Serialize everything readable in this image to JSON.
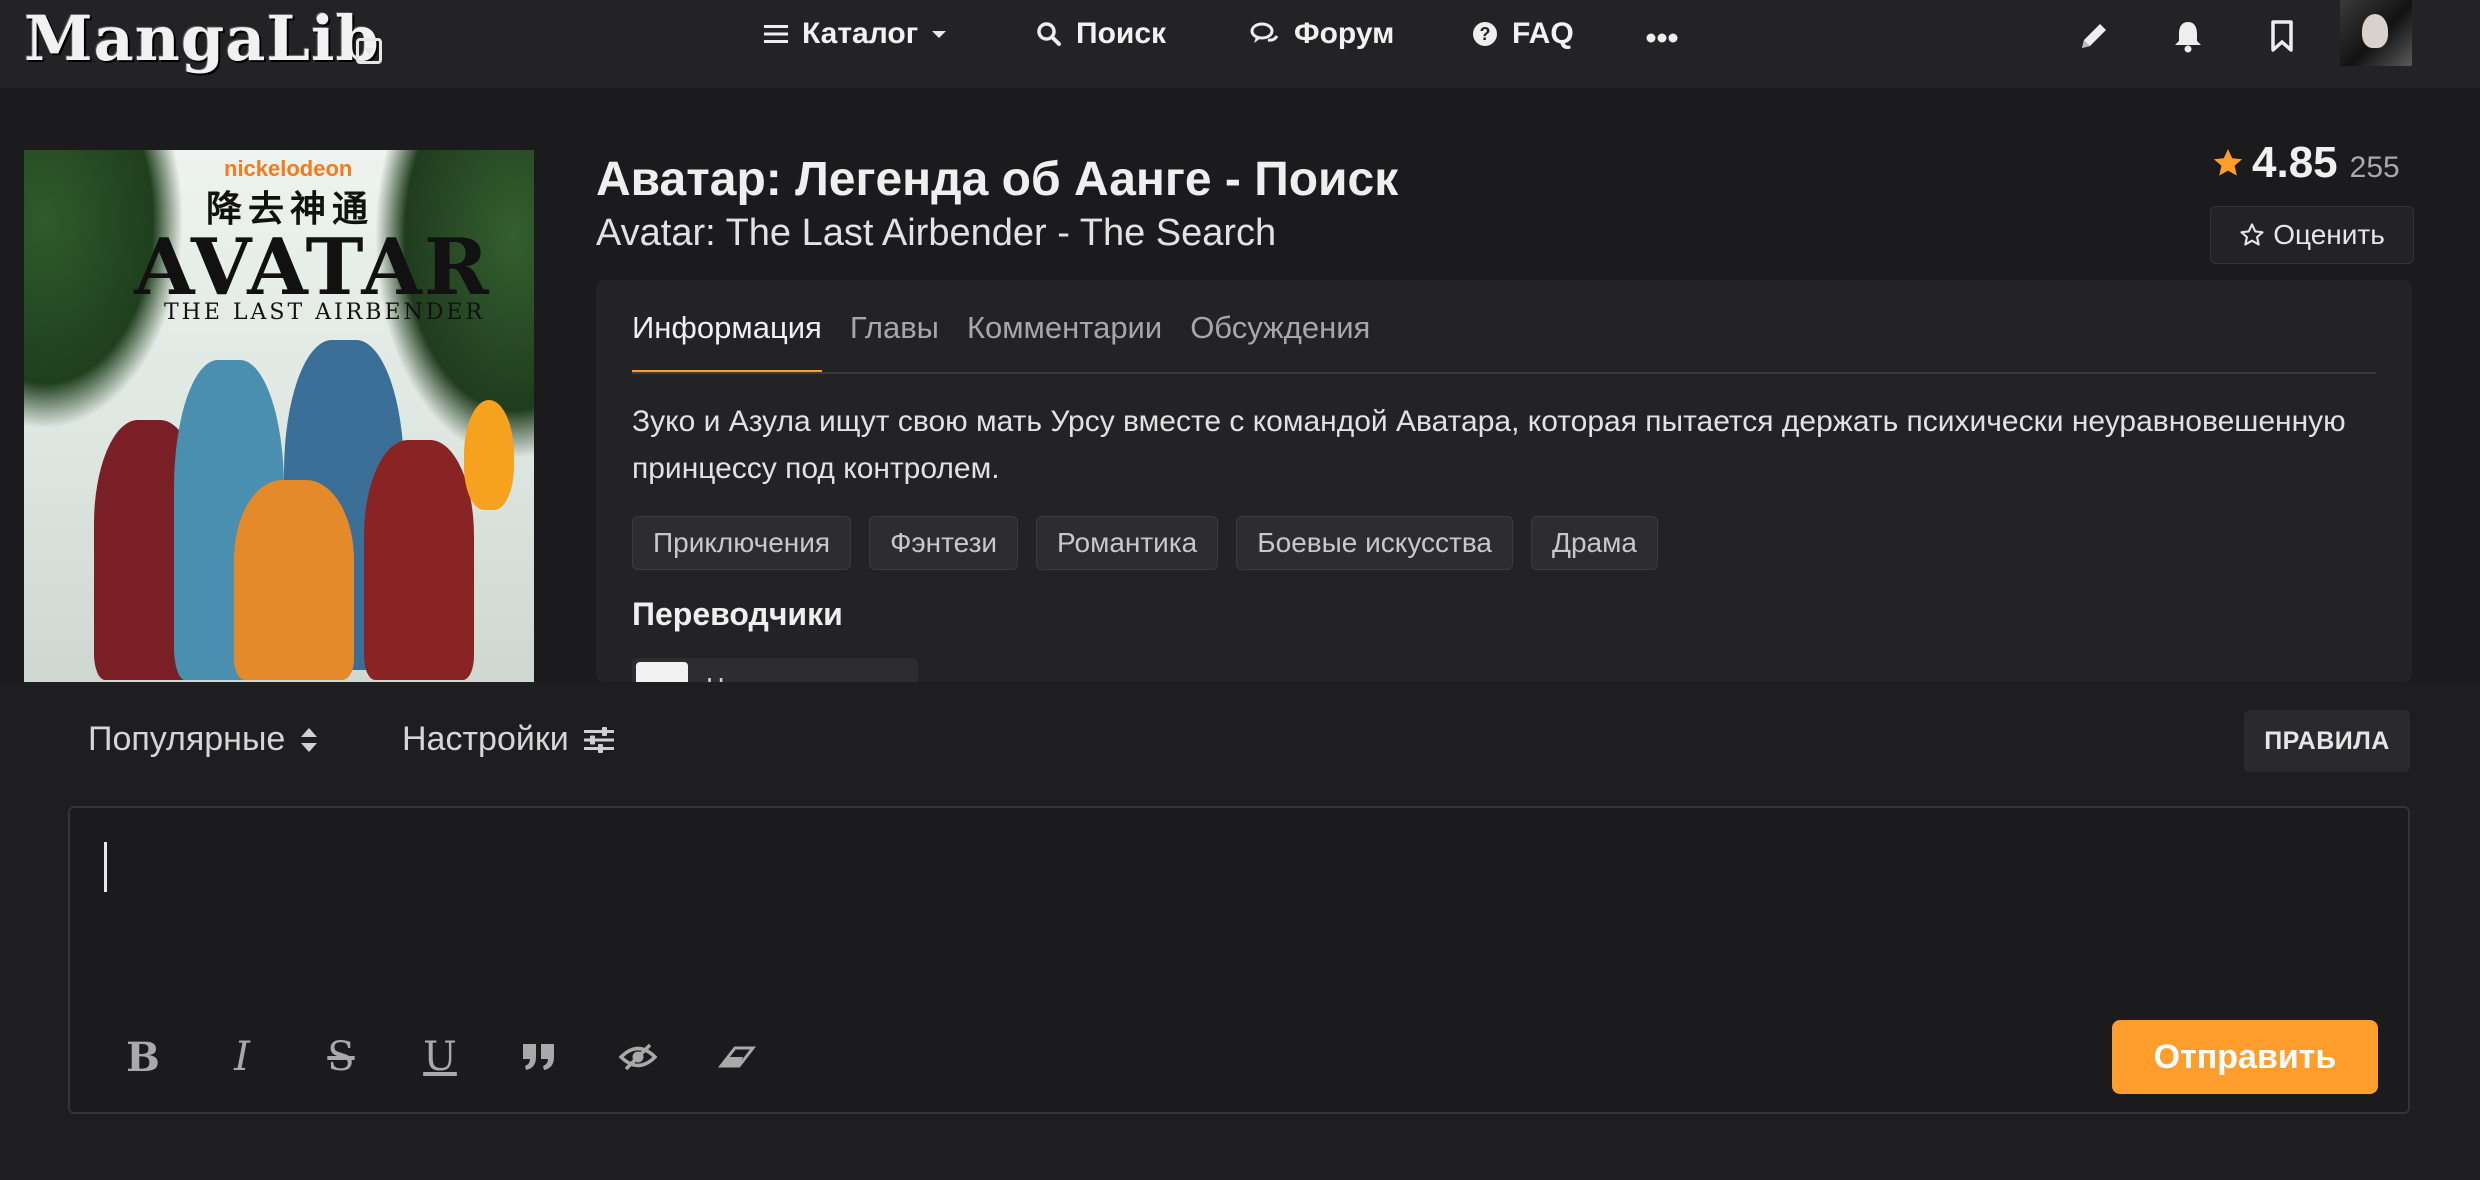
{
  "header": {
    "logo": "MangaLib",
    "nav": [
      {
        "label": "Каталог",
        "icon": "menu-icon"
      },
      {
        "label": "Поиск",
        "icon": "search-icon"
      },
      {
        "label": "Форум",
        "icon": "chat-icon"
      },
      {
        "label": "FAQ",
        "icon": "help-icon"
      }
    ],
    "more_icon": "ellipsis-icon",
    "actions": [
      "pencil-icon",
      "bell-icon",
      "bookmark-icon"
    ]
  },
  "manga": {
    "cover": {
      "brand": "nickelodeon",
      "cjk_title": "降去神通",
      "title": "AVATAR",
      "subtitle": "THE LAST AIRBENDER"
    },
    "title_ru": "Аватар: Легенда об Аанге - Поиск",
    "title_en": "Avatar: The Last Airbender - The Search",
    "rating": {
      "value": "4.85",
      "count": "255"
    },
    "rate_button": "Оценить",
    "tabs": [
      {
        "label": "Информация",
        "active": true
      },
      {
        "label": "Главы",
        "active": false
      },
      {
        "label": "Комментарии",
        "active": false
      },
      {
        "label": "Обсуждения",
        "active": false
      }
    ],
    "description": "Зуко и Азула ищут свою мать Урсу вместе с командой Аватара, которая пытается держать психически неуравновешенную принцессу под контролем.",
    "genres": [
      "Приключения",
      "Фэнтези",
      "Романтика",
      "Боевые искусства",
      "Драма"
    ],
    "translators_heading": "Переводчики",
    "translator_team": "Чудо-камикадзе"
  },
  "comments": {
    "sort_label": "Популярные",
    "settings_label": "Настройки",
    "rules_button": "ПРАВИЛА",
    "input_value": "",
    "toolbar": [
      "bold-icon",
      "italic-icon",
      "strikethrough-icon",
      "underline-icon",
      "quote-icon",
      "spoiler-icon",
      "eraser-icon"
    ],
    "submit_button": "Отправить"
  },
  "colors": {
    "accent": "#ff9e2c",
    "background": "#1b1b1d",
    "panel": "#232325"
  }
}
